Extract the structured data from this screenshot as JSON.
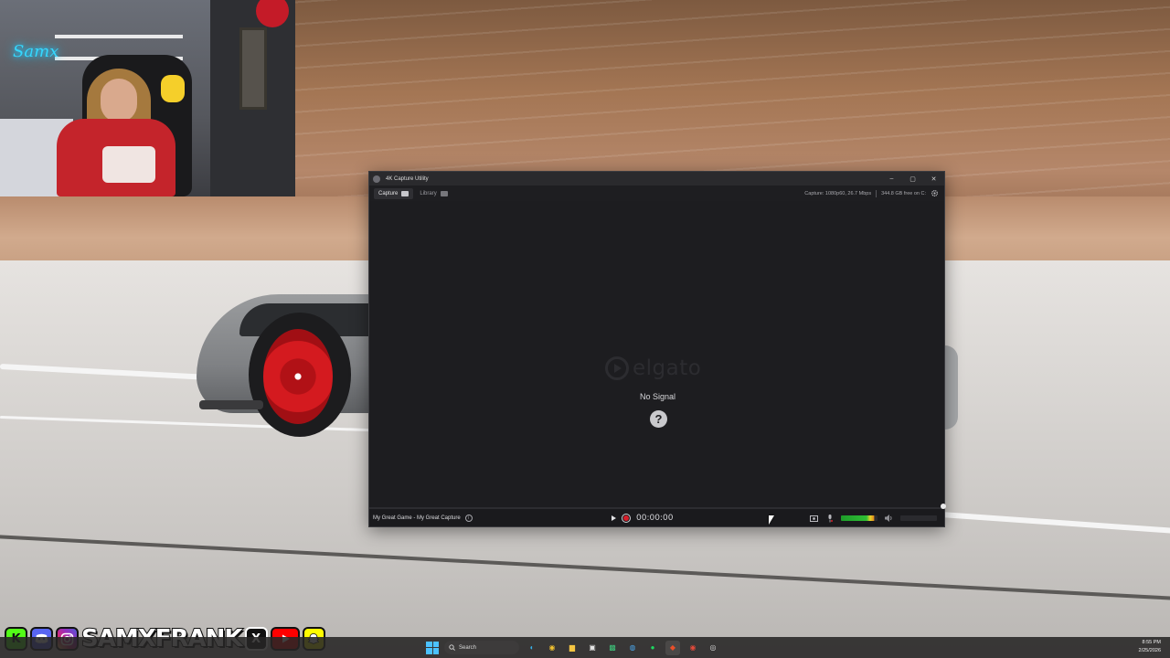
{
  "app_window": {
    "title": "4K Capture Utility",
    "controls": {
      "minimize": "–",
      "maximize": "▢",
      "close": "✕"
    },
    "tabs": [
      {
        "label": "Capture",
        "active": true
      },
      {
        "label": "Library",
        "active": false
      }
    ],
    "status": {
      "capture_info": "Capture: 1080p60, 26.7 Mbps",
      "free_space": "344.8 GB free on C:"
    },
    "preview": {
      "logo_text": "elgato",
      "message": "No Signal",
      "help_symbol": "?"
    },
    "bottom": {
      "capture_name": "My Great Game - My Great Capture",
      "info_symbol": "i",
      "timecode": "00:00:00",
      "audio_level": 0.8
    }
  },
  "webcam": {
    "neon_sign": "Samx"
  },
  "social": {
    "handle": "SAMXFRANK",
    "icons": [
      "kick-icon",
      "discord-icon",
      "instagram-icon",
      "x-icon",
      "youtube-icon",
      "snapchat-icon"
    ]
  },
  "taskbar": {
    "search_placeholder": "Search",
    "time": "8:55 PM",
    "date": "2/25/2026"
  },
  "colors": {
    "window_bg": "#1d1d20",
    "record_red": "#d81e2a",
    "meter_green": "#2fbf35",
    "neon_blue": "#35d8ff",
    "kick_green": "#53fc18"
  }
}
